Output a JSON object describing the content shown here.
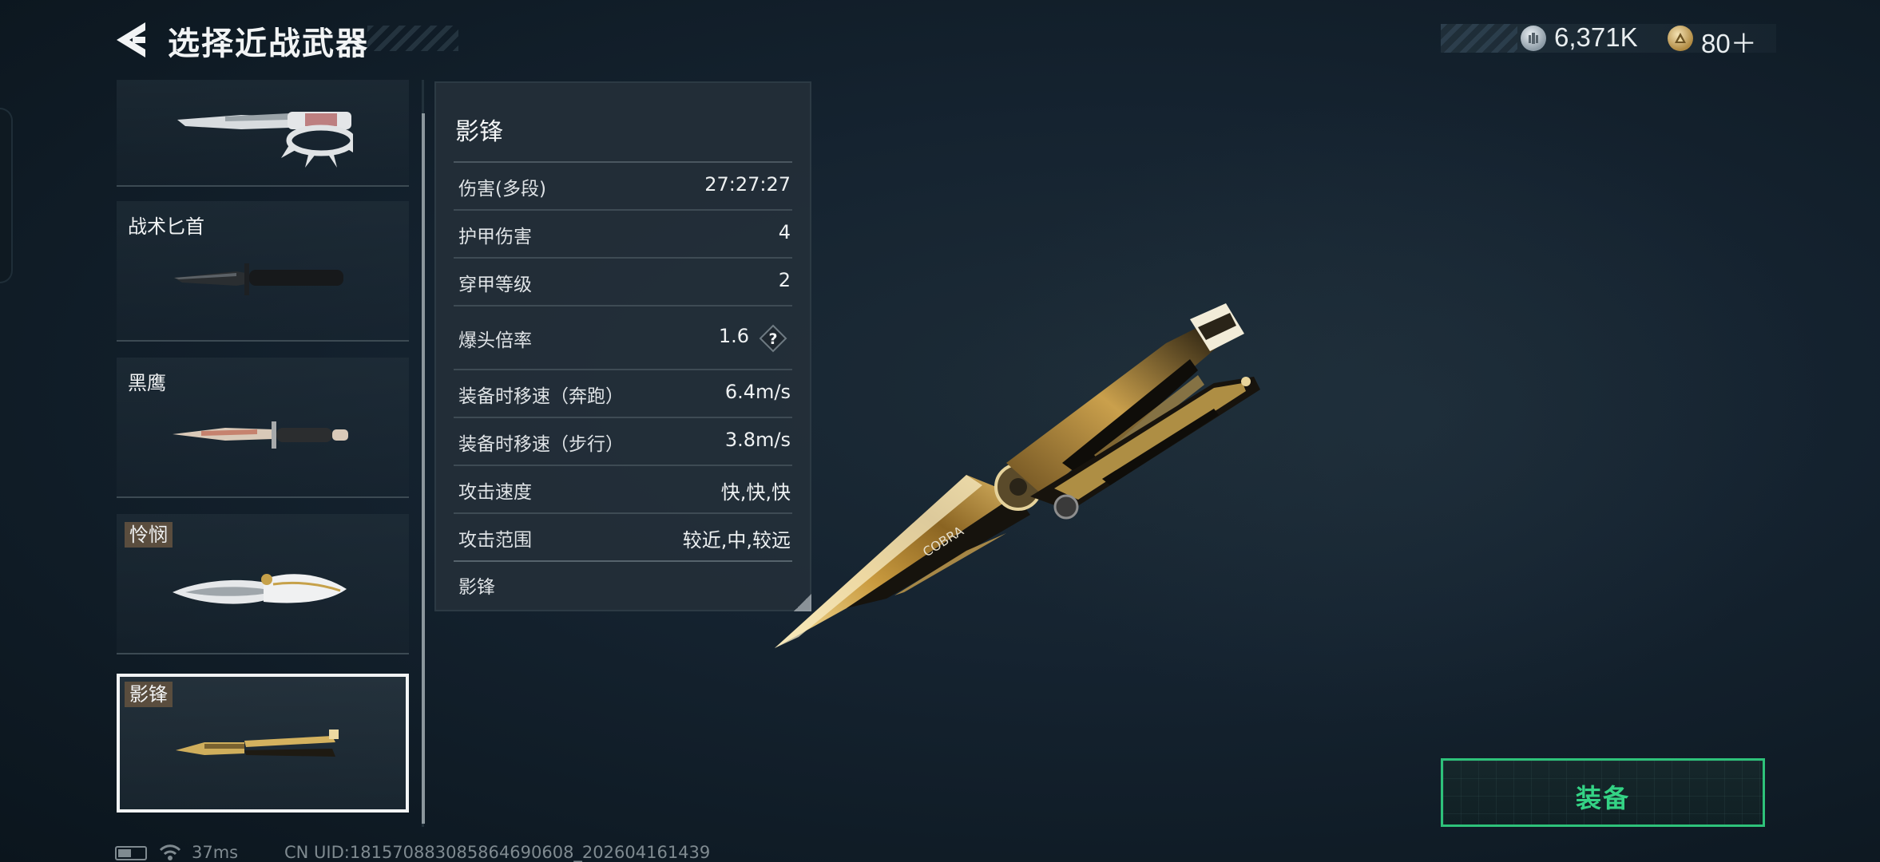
{
  "header": {
    "title": "选择近战武器",
    "currency": {
      "silver_value": "6,371K",
      "gold_value": "80＋"
    }
  },
  "weapons": [
    {
      "name": "",
      "tag": false
    },
    {
      "name": "战术匕首",
      "tag": false
    },
    {
      "name": "黑鹰",
      "tag": false
    },
    {
      "name": "怜悯",
      "tag": true
    },
    {
      "name": "影锋",
      "tag": true,
      "selected": true
    }
  ],
  "stats": {
    "title": "影锋",
    "rows": [
      {
        "label": "伤害(多段)",
        "value": "27:27:27"
      },
      {
        "label": "护甲伤害",
        "value": "4"
      },
      {
        "label": "穿甲等级",
        "value": "2"
      },
      {
        "label": "爆头倍率",
        "value": "1.6",
        "help": "?"
      },
      {
        "label": "装备时移速（奔跑）",
        "value": "6.4m/s"
      },
      {
        "label": "装备时移速（步行）",
        "value": "3.8m/s"
      },
      {
        "label": "攻击速度",
        "value": "快,快,快"
      },
      {
        "label": "攻击范围",
        "value": "较近,中,较远"
      }
    ],
    "footer": "影锋"
  },
  "render": {
    "brand": "COBRA"
  },
  "equip_button": {
    "label": "装备"
  },
  "status": {
    "ping": "37ms",
    "uid": "CN UID:181570883085864690608_202604161439"
  },
  "colors": {
    "accent_green": "#2ec27a",
    "gold": "#c9a24a",
    "background": "#132029"
  }
}
